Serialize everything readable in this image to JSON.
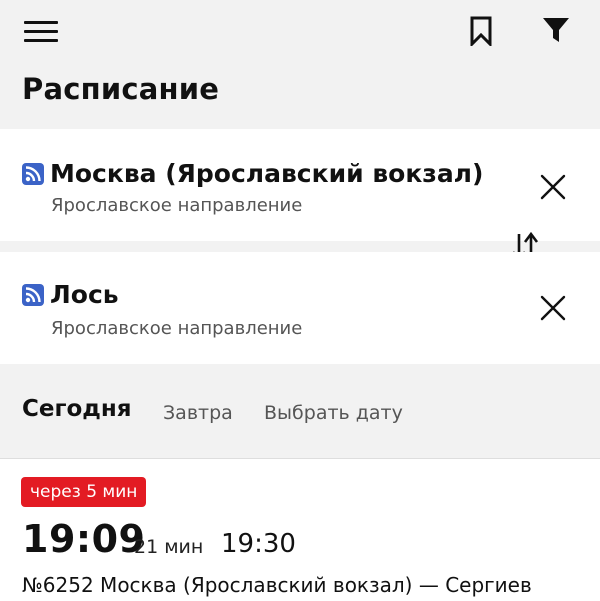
{
  "header": {
    "title": "Расписание"
  },
  "icons": {
    "menu": "hamburger-icon",
    "bookmark": "bookmark-icon",
    "filter": "filter-icon",
    "station": "suburban-rail-icon",
    "clear": "close-icon",
    "swap": "swap-vertical-icon"
  },
  "route": {
    "from": {
      "name": "Москва (Ярославский вокзал)",
      "direction": "Ярославское направление"
    },
    "to": {
      "name": "Лось",
      "direction": "Ярославское направление"
    }
  },
  "date_tabs": [
    {
      "label": "Сегодня",
      "selected": true
    },
    {
      "label": "Завтра",
      "selected": false
    },
    {
      "label": "Выбрать дату",
      "selected": false
    }
  ],
  "trains": [
    {
      "badge": "через 5 мин",
      "departure": "19:09",
      "duration": "21 мин",
      "arrival": "19:30",
      "route": "№6252 Москва (Ярославский вокзал) — Сергиев"
    }
  ],
  "colors": {
    "accent_red": "#e31b23",
    "rail_icon_blue": "#3b63c7",
    "background": "#f2f2f2",
    "card": "#ffffff"
  }
}
